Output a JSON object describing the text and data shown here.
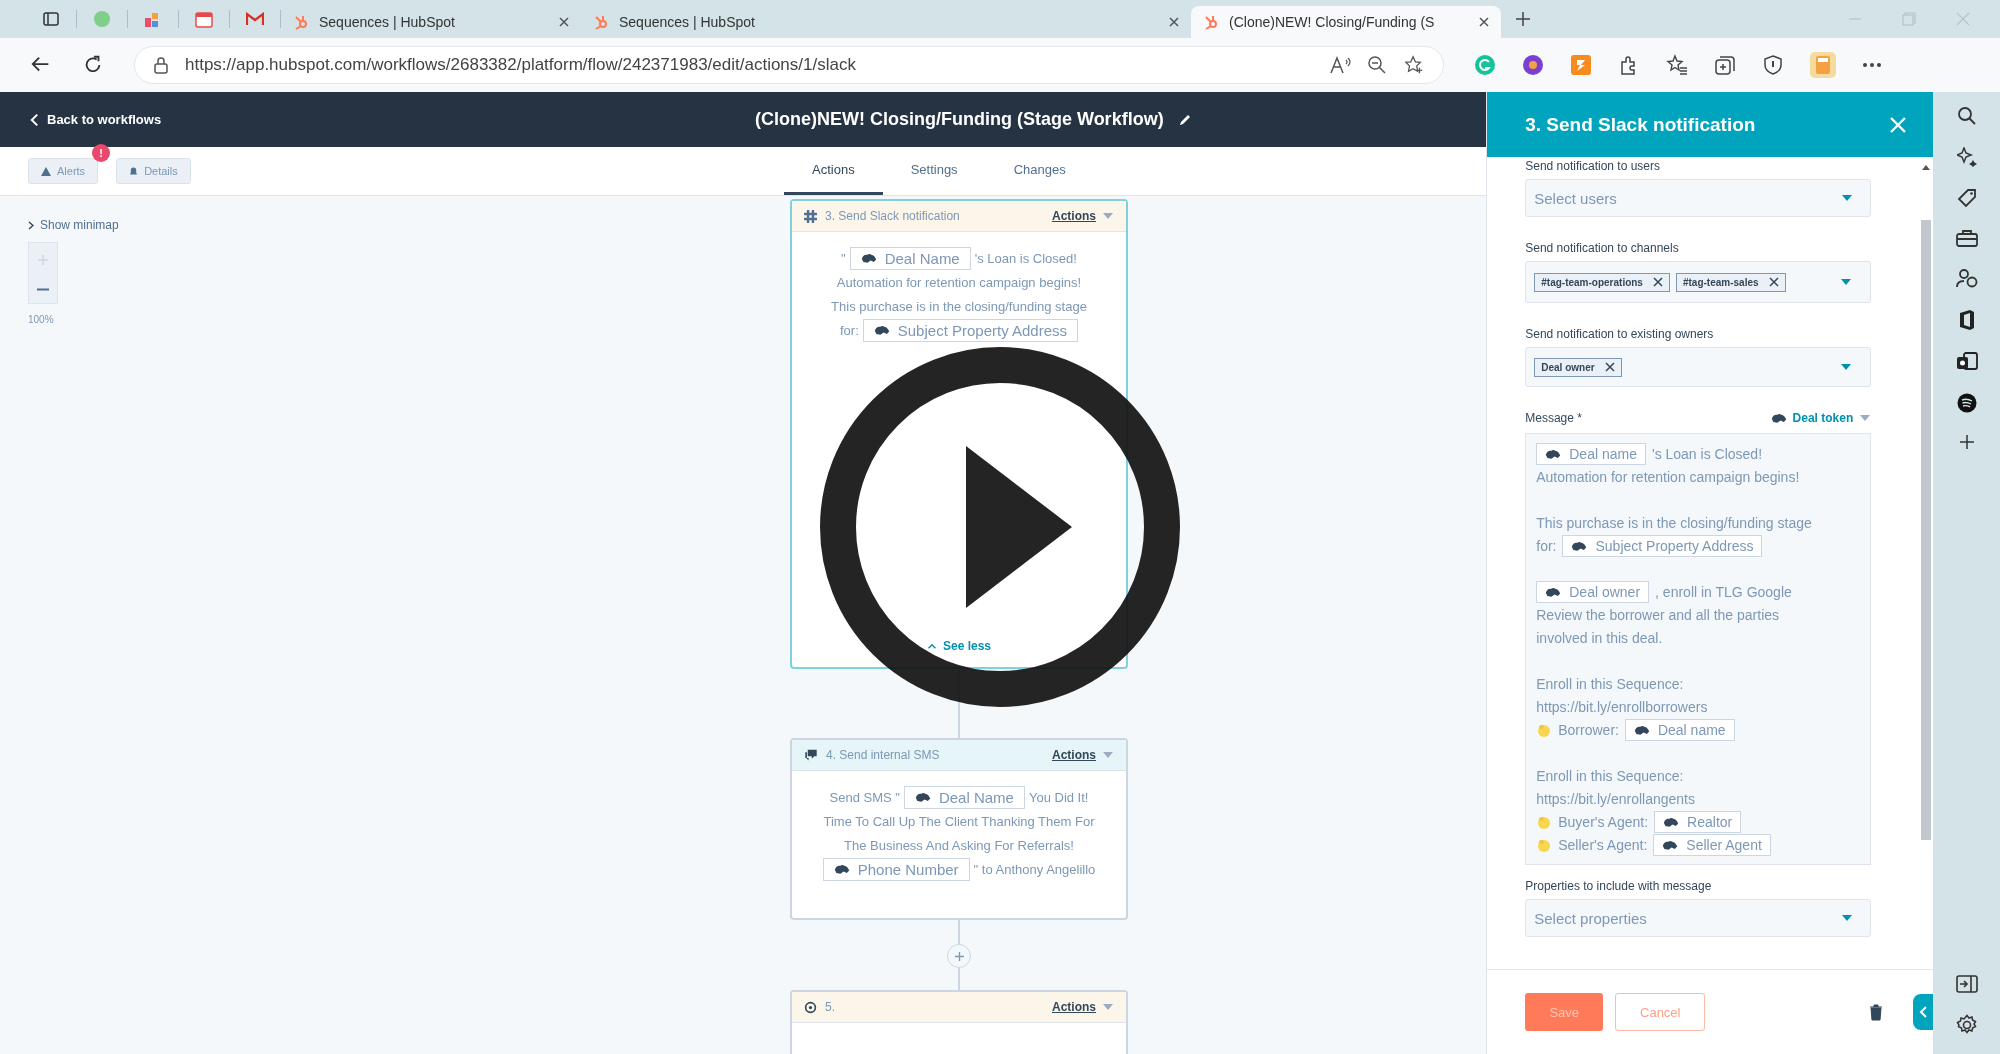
{
  "browser": {
    "tabs": [
      {
        "title": "Sequences | HubSpot",
        "selected": false
      },
      {
        "title": "Sequences | HubSpot",
        "selected": false
      },
      {
        "title": "(Clone)NEW! Closing/Funding (S",
        "selected": true
      }
    ],
    "url": "https://app.hubspot.com/workflows/2683382/platform/flow/242371983/edit/actions/1/slack"
  },
  "header": {
    "back": "Back to workflows",
    "title": "(Clone)NEW! Closing/Funding (Stage Workflow)"
  },
  "toolbar": {
    "alerts": "Alerts",
    "alerts_badge": "!",
    "details": "Details",
    "tabs": [
      {
        "label": "Actions",
        "selected": true
      },
      {
        "label": "Settings",
        "selected": false
      },
      {
        "label": "Changes",
        "selected": false
      }
    ]
  },
  "canvas": {
    "minimap": "Show minimap",
    "zoom": "100%",
    "cards": [
      {
        "kind": "slack",
        "title": "3. Send Slack notification",
        "actions": "Actions",
        "selected": true,
        "color": "#fcf6ea",
        "lines": [
          [
            {
              "kind": "text",
              "text": "\""
            },
            {
              "kind": "token",
              "text": "Deal Name"
            },
            {
              "kind": "text",
              "text": "'s Loan is Closed!"
            }
          ],
          [
            {
              "kind": "text",
              "text": "Automation for retention campaign begins!"
            }
          ],
          [
            {
              "kind": "text",
              "text": "This purchase is in the closing/funding stage"
            }
          ],
          [
            {
              "kind": "text",
              "text": "for:"
            },
            {
              "kind": "token",
              "text": "Subject Property Address"
            }
          ]
        ],
        "link": "See less"
      },
      {
        "kind": "sms",
        "title": "4. Send internal SMS",
        "actions": "Actions",
        "selected": false,
        "color": "#e6f5f7",
        "lines": [
          [
            {
              "kind": "text",
              "text": "Send SMS \""
            },
            {
              "kind": "token",
              "text": "Deal Name"
            },
            {
              "kind": "text",
              "text": "You Did It!"
            }
          ],
          [
            {
              "kind": "text",
              "text": "Time To Call Up The Client Thanking Them For"
            }
          ],
          [
            {
              "kind": "text",
              "text": "The Business And Asking For Referrals!"
            }
          ],
          [
            {
              "kind": "token",
              "text": "Phone Number"
            },
            {
              "kind": "text",
              "text": "\" to Anthony Angelillo"
            }
          ]
        ]
      },
      {
        "kind": "branch",
        "title": "5.",
        "actions": "Actions",
        "selected": false,
        "color": "#fcf6ea"
      }
    ]
  },
  "panel": {
    "title": "3. Send Slack notification",
    "fields": [
      {
        "label": "Send notification to users",
        "placeholder": "Select users"
      },
      {
        "label": "Send notification to channels",
        "chips": [
          "#tag-team-operations",
          "#tag-team-sales"
        ]
      },
      {
        "label": "Send notification to existing owners",
        "chips": [
          "Deal owner"
        ]
      }
    ],
    "message": {
      "label": "Message *",
      "token_menu": "Deal token",
      "paragraphs": [
        [
          [
            {
              "kind": "token",
              "text": "Deal name"
            },
            {
              "kind": "text",
              "text": "'s Loan is Closed!"
            }
          ],
          [
            {
              "kind": "text",
              "text": "Automation for retention campaign begins!"
            }
          ]
        ],
        [
          [
            {
              "kind": "text",
              "text": "This purchase is in the closing/funding stage"
            }
          ],
          [
            {
              "kind": "text",
              "text": "for:"
            },
            {
              "kind": "token",
              "text": "Subject Property Address"
            }
          ]
        ],
        [
          [
            {
              "kind": "token",
              "text": "Deal owner"
            },
            {
              "kind": "text",
              "text": ", enroll in TLG Google"
            }
          ],
          [
            {
              "kind": "text",
              "text": "Review the borrower and all the parties"
            }
          ],
          [
            {
              "kind": "text",
              "text": "involved in this deal."
            }
          ]
        ],
        [
          [
            {
              "kind": "text",
              "text": "Enroll in this Sequence:"
            }
          ],
          [
            {
              "kind": "text",
              "text": "https://bit.ly/enrollborrowers"
            }
          ],
          [
            {
              "kind": "emoji"
            },
            {
              "kind": "text",
              "text": "Borrower:"
            },
            {
              "kind": "token",
              "text": "Deal name"
            }
          ]
        ],
        [
          [
            {
              "kind": "text",
              "text": "Enroll in this Sequence:"
            }
          ],
          [
            {
              "kind": "text",
              "text": "https://bit.ly/enrollangents"
            }
          ],
          [
            {
              "kind": "emoji"
            },
            {
              "kind": "text",
              "text": "Buyer's Agent:"
            },
            {
              "kind": "token",
              "text": "Realtor"
            }
          ],
          [
            {
              "kind": "emoji"
            },
            {
              "kind": "text",
              "text": "Seller's Agent:"
            },
            {
              "kind": "token",
              "text": "Seller Agent"
            }
          ]
        ]
      ]
    },
    "properties": {
      "label": "Properties to include with message",
      "placeholder": "Select properties"
    },
    "save": "Save",
    "cancel": "Cancel"
  }
}
